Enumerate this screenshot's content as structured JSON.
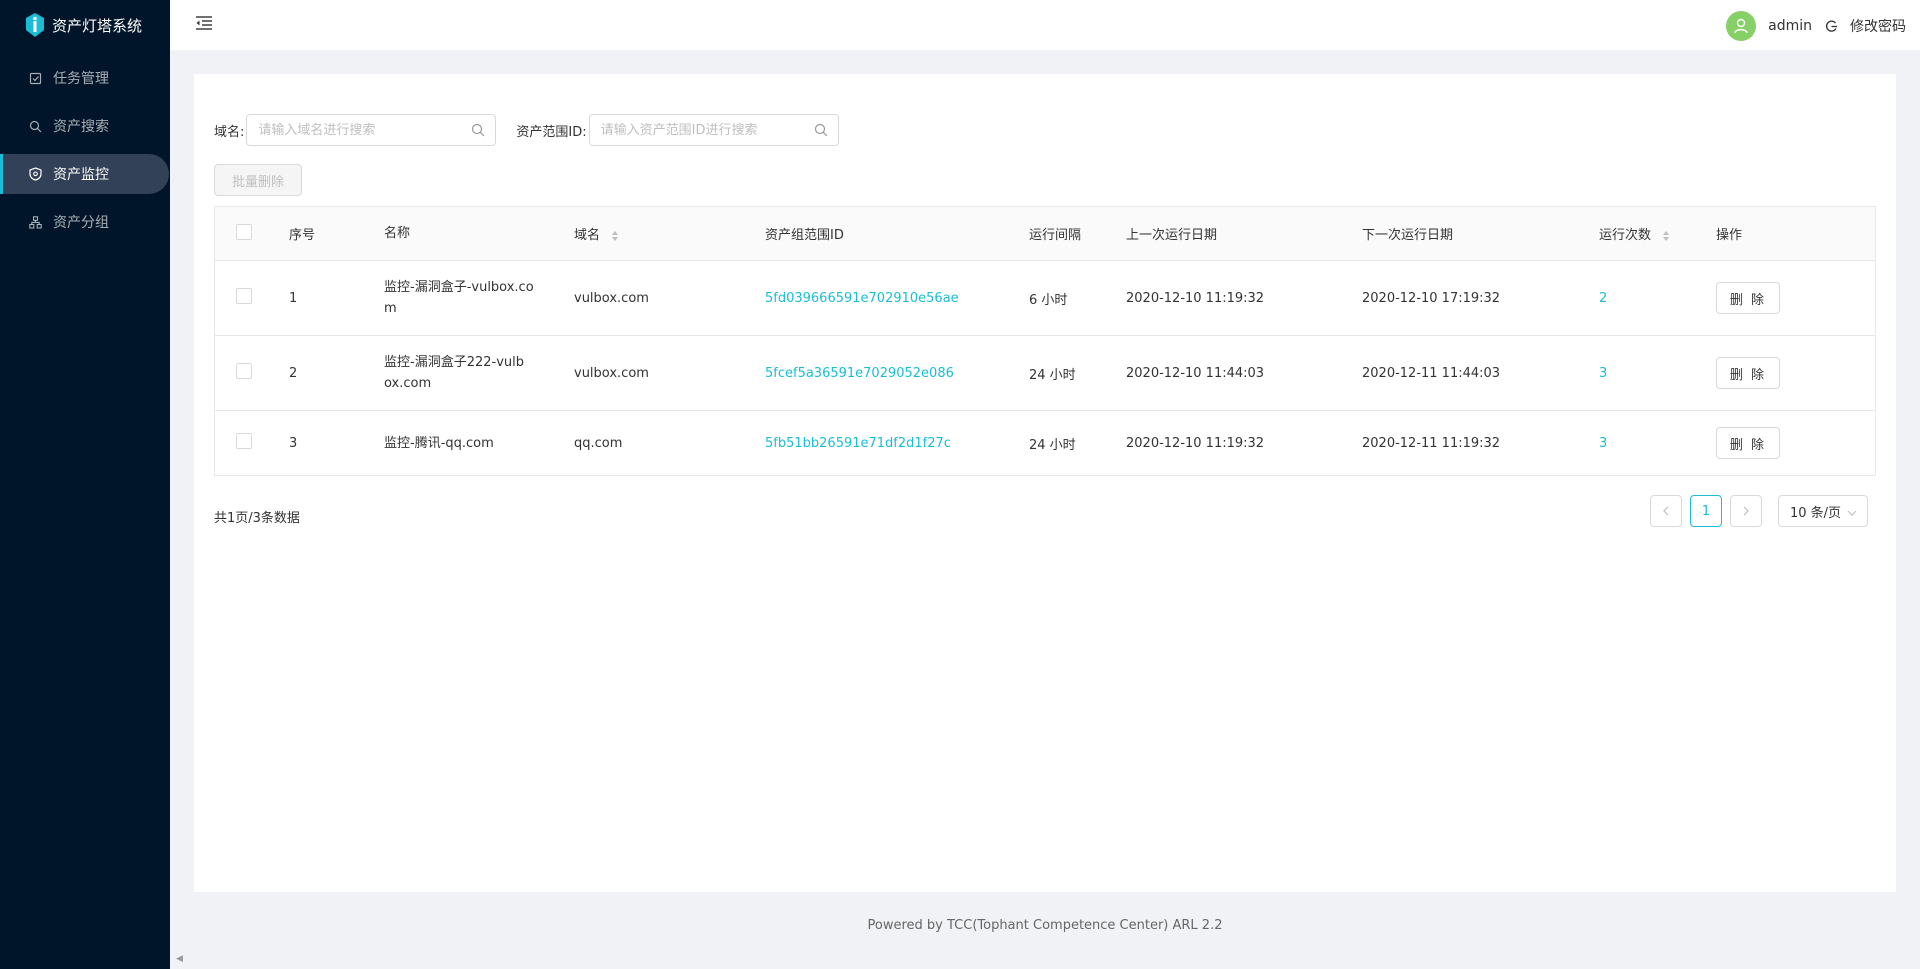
{
  "app": {
    "title": "资产灯塔系统"
  },
  "sidebar": {
    "items": [
      {
        "label": "任务管理",
        "icon": "task-icon"
      },
      {
        "label": "资产搜索",
        "icon": "search-icon"
      },
      {
        "label": "资产监控",
        "icon": "monitor-shield-icon",
        "active": true
      },
      {
        "label": "资产分组",
        "icon": "group-tree-icon"
      }
    ]
  },
  "header": {
    "username": "admin",
    "change_password": "修改密码"
  },
  "search": {
    "domain_label": "域名:",
    "domain_placeholder": "请输入域名进行搜索",
    "scope_label": "资产范围ID:",
    "scope_placeholder": "请输入资产范围ID进行搜索"
  },
  "toolbar": {
    "batch_delete": "批量删除"
  },
  "table": {
    "headers": {
      "index": "序号",
      "name": "名称",
      "domain": "域名",
      "scope_id": "资产组范围ID",
      "interval": "运行间隔",
      "last_run": "上一次运行日期",
      "next_run": "下一次运行日期",
      "run_count": "运行次数",
      "action": "操作"
    },
    "rows": [
      {
        "index": "1",
        "name": "监控-漏洞盒子-vulbox.com",
        "domain": "vulbox.com",
        "scope_id": "5fd039666591e702910e56ae",
        "interval": "6 小时",
        "last_run": "2020-12-10 11:19:32",
        "next_run": "2020-12-10 17:19:32",
        "run_count": "2",
        "action": "删 除"
      },
      {
        "index": "2",
        "name": "监控-漏洞盒子222-vulbox.com",
        "domain": "vulbox.com",
        "scope_id": "5fcef5a36591e7029052e086",
        "interval": "24 小时",
        "last_run": "2020-12-10 11:44:03",
        "next_run": "2020-12-11 11:44:03",
        "run_count": "3",
        "action": "删 除"
      },
      {
        "index": "3",
        "name": "监控-腾讯-qq.com",
        "domain": "qq.com",
        "scope_id": "5fb51bb26591e71df2d1f27c",
        "interval": "24 小时",
        "last_run": "2020-12-10 11:19:32",
        "next_run": "2020-12-11 11:19:32",
        "run_count": "3",
        "action": "删 除"
      }
    ]
  },
  "pagination": {
    "summary": "共1页/3条数据",
    "current_page": "1",
    "page_size": "10 条/页"
  },
  "footer": {
    "text": "Powered by TCC(Tophant Competence Center) ARL 2.2"
  },
  "colors": {
    "sidebar_bg": "#001529",
    "accent": "#1abdd5",
    "avatar_bg": "#87d068"
  }
}
